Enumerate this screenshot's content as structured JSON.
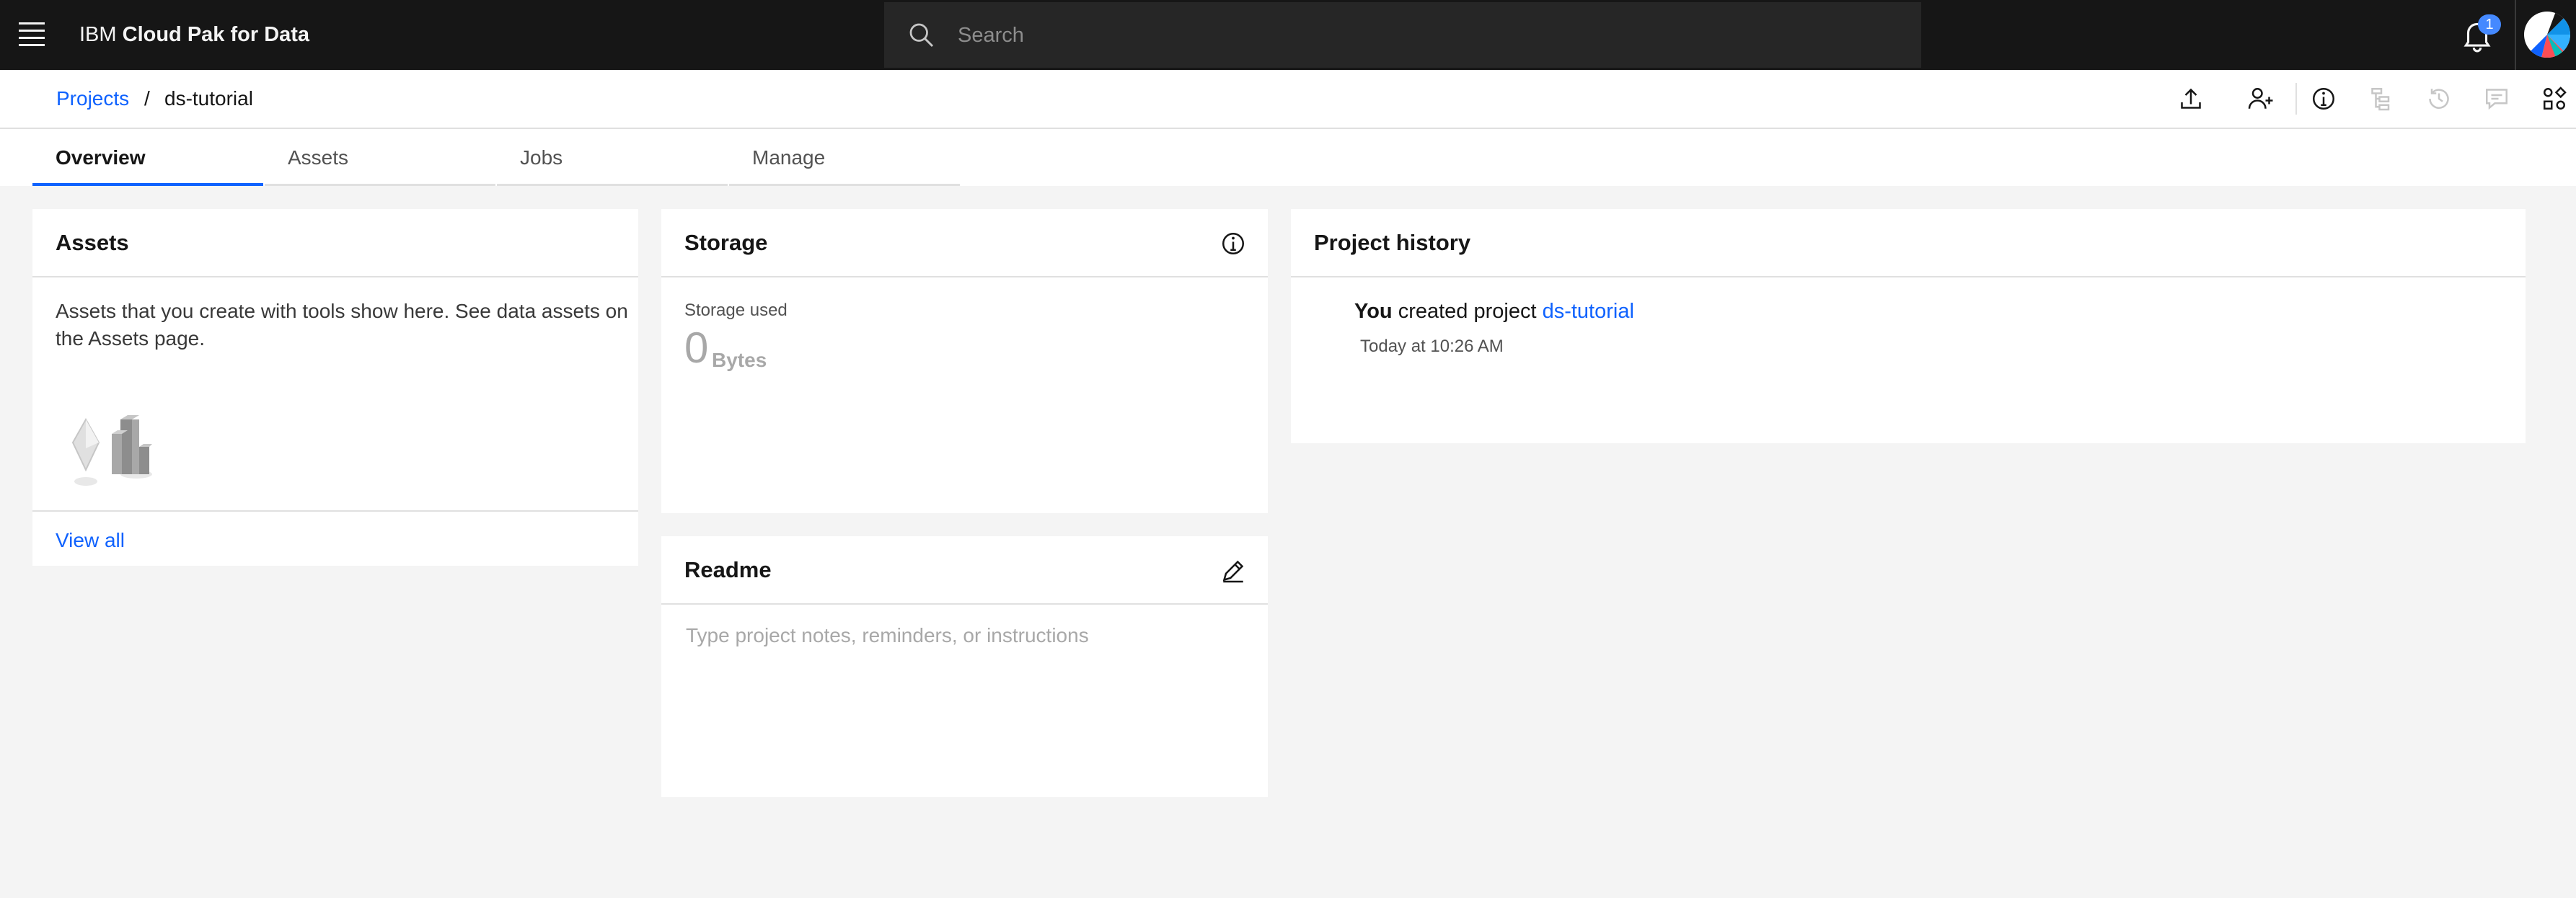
{
  "header": {
    "brand_prefix": "IBM",
    "brand_name": "Cloud Pak for Data",
    "search_placeholder": "Search",
    "notification_count": "1"
  },
  "breadcrumb": {
    "parent": "Projects",
    "separator": "/",
    "current": "ds-tutorial"
  },
  "toolbar": {
    "icons": [
      "upload-icon",
      "add-collaborator-icon",
      "info-icon",
      "lineage-icon",
      "history-icon",
      "comments-icon",
      "apps-icon"
    ]
  },
  "tabs": [
    {
      "label": "Overview",
      "active": true
    },
    {
      "label": "Assets",
      "active": false
    },
    {
      "label": "Jobs",
      "active": false
    },
    {
      "label": "Manage",
      "active": false
    }
  ],
  "assets_card": {
    "title": "Assets",
    "description": "Assets that you create with tools show here. See data assets on the Assets page.",
    "link": "View all"
  },
  "storage_card": {
    "title": "Storage",
    "used_label": "Storage used",
    "used_value": "0",
    "used_unit": "Bytes"
  },
  "readme_card": {
    "title": "Readme",
    "placeholder": "Type project notes, reminders, or instructions"
  },
  "history_card": {
    "title": "Project history",
    "entries": [
      {
        "actor": "You",
        "action": "created project",
        "target": "ds-tutorial",
        "time": "Today at 10:26 AM"
      }
    ]
  },
  "colors": {
    "header_bg": "#161616",
    "accent": "#0f62fe",
    "page_bg": "#f4f4f4",
    "badge": "#4589ff"
  }
}
